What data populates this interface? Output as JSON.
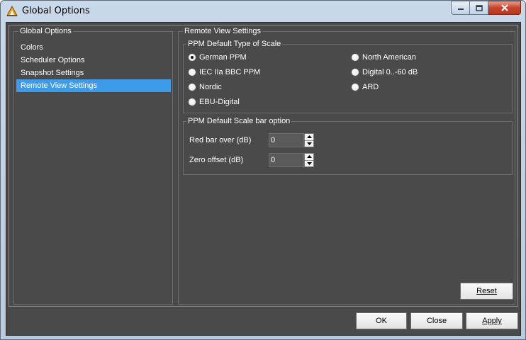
{
  "window": {
    "title": "Global Options"
  },
  "nav": {
    "group_label": "Global Options",
    "items": [
      {
        "label": "Colors",
        "selected": false
      },
      {
        "label": "Scheduler Options",
        "selected": false
      },
      {
        "label": "Snapshot Settings",
        "selected": false
      },
      {
        "label": "Remote View Settings",
        "selected": true
      }
    ]
  },
  "remote": {
    "group_label": "Remote View Settings",
    "scale_type": {
      "label": "PPM Default Type of Scale",
      "options": [
        {
          "label": "German PPM",
          "checked": true
        },
        {
          "label": "IEC IIa BBC PPM",
          "checked": false
        },
        {
          "label": "Nordic",
          "checked": false
        },
        {
          "label": "EBU-Digital",
          "checked": false
        },
        {
          "label": "North American",
          "checked": false
        },
        {
          "label": "Digital 0..-60 dB",
          "checked": false
        },
        {
          "label": "ARD",
          "checked": false
        }
      ]
    },
    "scale_bar": {
      "label": "PPM Default Scale bar option",
      "red_bar_label": "Red bar over (dB)",
      "red_bar_value": "0",
      "zero_offset_label": "Zero offset (dB)",
      "zero_offset_value": "0"
    },
    "reset_label": "Reset"
  },
  "footer": {
    "ok_label": "OK",
    "close_label": "Close",
    "apply_label": "Apply"
  }
}
